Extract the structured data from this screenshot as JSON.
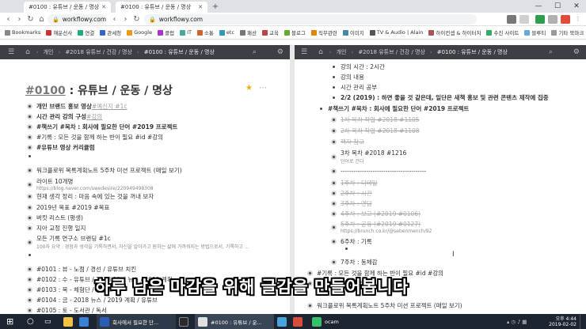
{
  "browser": {
    "tabs": [
      {
        "label": "#0100 : 유튜브 / 운동 / 명상"
      },
      {
        "label": "#0100 : 유튜브 / 운동 / 명상"
      }
    ],
    "new_tab": "+",
    "window_controls": {
      "min": "—",
      "max": "☐",
      "close": "✕"
    },
    "urls": [
      "workflowy.com",
      "workflowy.com"
    ],
    "bookmarks": [
      "Bookmarks",
      "해운선사",
      "연결",
      "관세청",
      "Google",
      "클럽",
      "IT",
      "소통",
      "etc",
      "패션",
      "교육",
      "블로그",
      "직무관련",
      "이미지",
      "TV & Audio | Alain",
      "하이컨셉 & 하이터치",
      "수진 사이트",
      "블루티",
      "기타 북마크"
    ]
  },
  "left_pane": {
    "breadcrumb": [
      "개인",
      "#2018 유튜브 / 건강 / 명상",
      "#0100 : 유튜브 / 운동 / 명상"
    ],
    "title_tag": "#0100",
    "title_rest": " : 유튜브 / 운동 / 명상",
    "items": [
      {
        "text": "개인 브랜드 홍보 영상 ",
        "tags": "#예신지 #1c"
      },
      {
        "text": "시간 관리 강의 구성 ",
        "tags": "#강의"
      },
      {
        "text": "#책쓰기 #목차 : 회사에 필요한 단어 #2019 프로젝트"
      },
      {
        "text": "#기록 : 모든 것을 함께 하는 반이 필요 #id #강의"
      },
      {
        "text": "#유튜브 영상 커리큘럼"
      },
      {
        "text": ""
      },
      {
        "text": "워크플로위 목록계획노트 5주차 미션 프로젝트 (매일 보기)"
      },
      {
        "text": "라이트 10개명",
        "note": "https://blog.naver.com/swedesire/220949498308"
      },
      {
        "text": "현재 생각 정리 : 마음 속에 있는 것을 꺼내 보자"
      },
      {
        "text": "2019년 목표 #2019 #목표"
      },
      {
        "text": "버킷 리스트 (평생)"
      },
      {
        "text": "지아 교정 진행 일지"
      },
      {
        "text": "모든 기록 연구소 브랜딩 #1c",
        "note": "100자 요약 : 경험과 생각을 기록하면서, 자신을 알아가고 원하는 삶에 가까워지는 방법으로서, 기록하고 ..."
      },
      {
        "text": ""
      },
      {
        "text": "#0101 : 뷰 - 노점 / 경선 / 유튜브 치킨"
      },
      {
        "text": "#0102 : 수 - 유튜브 / 2018 10대 뉴스 / 2019 계획"
      },
      {
        "text": "#0103 : 목 - 체험단 / 유튜브"
      },
      {
        "text": "#0104 : 금 - 2018 뉴스 / 2019 계획 / 유튜브"
      },
      {
        "text": "#0105 : 토 - 도서관 / 독서"
      }
    ]
  },
  "right_pane": {
    "breadcrumb": [
      "개인",
      "#2018 유튜브 / 건강 / 명상",
      "#0100 : 유튜브 / 운동 / 명상"
    ],
    "items": [
      {
        "text": "강의 시간 : 2시간"
      },
      {
        "text": "강의 내용"
      },
      {
        "text": "시간 관리 공부"
      },
      {
        "text": "2/2 (2019) : 하면 좋을 것 같은데, 일단은 새책 홍보 및 관련 콘텐츠 제작에 집중"
      },
      {
        "text": "#책쓰기 #목차 : 회사에 필요한 단어 #2019 프로젝트"
      },
      {
        "text": "1차 목차 작업 #2018 #1105"
      },
      {
        "text": "2차 목차 작업 #2018 #1108"
      },
      {
        "text": "책자 참고"
      },
      {
        "text": "3차 목차 #2018 #1216",
        "note": "단어로 간다"
      },
      {
        "text": "----------------------------------------"
      },
      {
        "text": "1주차 : 디테일"
      },
      {
        "text": "2주차 : 시간"
      },
      {
        "text": "3주차 : 면담"
      },
      {
        "text": "4주차 : 보고 (#2019 #0106)"
      },
      {
        "text": "5주차 : 공유 (#2019 #0127)",
        "note": "https://brunch.co.kr/@sebenmench/92"
      },
      {
        "text": "6주차 : 기록"
      },
      {
        "text": ""
      },
      {
        "text": "7주차 : 동체감"
      },
      {
        "text": "#기록 : 모든 것을 함께 하는 반이 필요 #id #강의"
      },
      {
        "text": "#유튜브 영상 커리큘럼"
      },
      {
        "text": "워크플로위 목록계획노트 5주차 미션 프로젝트 (매일 보기)"
      }
    ]
  },
  "subtitle": "하루 남은 마감을 위해 글감을 만들어봅니다",
  "taskbar": {
    "apps": [
      "회사에서 필요한 단...",
      "#0100 : 유튜브 / 운...",
      "ocam"
    ],
    "clock_time": "오후 4:44",
    "clock_date": "2019-02-02"
  },
  "colors": {
    "accent": "#3c3f43",
    "tag": "#9e9e9e",
    "star": "#f0b400"
  }
}
